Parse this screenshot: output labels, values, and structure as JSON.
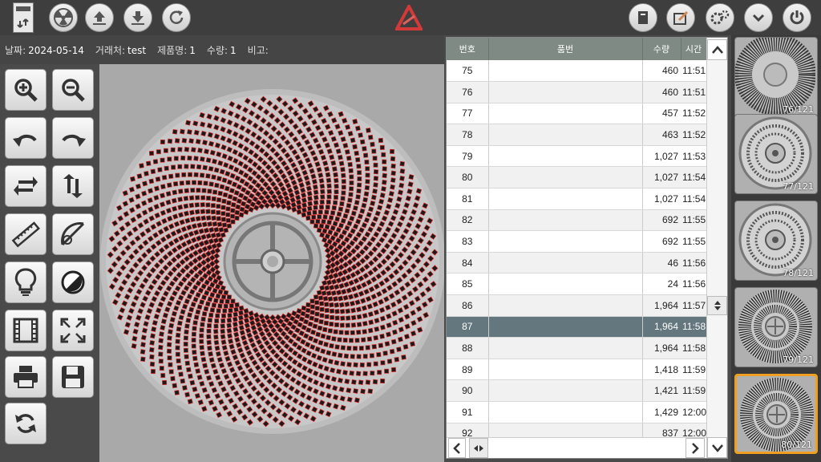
{
  "info": {
    "date_label": "날짜:",
    "date_value": "2024-05-14",
    "client_label": "거래처:",
    "client_value": "test",
    "product_label": "제품명:",
    "product_value": "1",
    "qty_label": "수량:",
    "qty_value": "1",
    "note_label": "비고:",
    "note_value": ""
  },
  "table": {
    "headers": [
      "번호",
      "품번",
      "수량",
      "시간"
    ],
    "rows": [
      {
        "no": "75",
        "part": "",
        "qty": "460",
        "time": "11:51"
      },
      {
        "no": "76",
        "part": "",
        "qty": "460",
        "time": "11:51"
      },
      {
        "no": "77",
        "part": "",
        "qty": "457",
        "time": "11:52"
      },
      {
        "no": "78",
        "part": "",
        "qty": "463",
        "time": "11:52"
      },
      {
        "no": "79",
        "part": "",
        "qty": "1,027",
        "time": "11:53"
      },
      {
        "no": "80",
        "part": "",
        "qty": "1,027",
        "time": "11:54"
      },
      {
        "no": "81",
        "part": "",
        "qty": "1,027",
        "time": "11:54"
      },
      {
        "no": "82",
        "part": "",
        "qty": "692",
        "time": "11:55"
      },
      {
        "no": "83",
        "part": "",
        "qty": "692",
        "time": "11:55"
      },
      {
        "no": "84",
        "part": "",
        "qty": "46",
        "time": "11:56"
      },
      {
        "no": "85",
        "part": "",
        "qty": "24",
        "time": "11:56"
      },
      {
        "no": "86",
        "part": "",
        "qty": "1,964",
        "time": "11:57"
      },
      {
        "no": "87",
        "part": "",
        "qty": "1,964",
        "time": "11:58"
      },
      {
        "no": "88",
        "part": "",
        "qty": "1,964",
        "time": "11:58"
      },
      {
        "no": "89",
        "part": "",
        "qty": "1,418",
        "time": "11:59"
      },
      {
        "no": "90",
        "part": "",
        "qty": "1,421",
        "time": "11:59"
      },
      {
        "no": "91",
        "part": "",
        "qty": "1,429",
        "time": "12:00"
      },
      {
        "no": "92",
        "part": "",
        "qty": "837",
        "time": "12:00"
      }
    ],
    "selected_row": "87"
  },
  "thumbnails": [
    {
      "count": "76/121",
      "style": "dense"
    },
    {
      "count": "77/121",
      "style": "reel"
    },
    {
      "count": "78/121",
      "style": "reel"
    },
    {
      "count": "79/121",
      "style": "spiral"
    },
    {
      "count": "80/121",
      "style": "spiral"
    }
  ],
  "selected_thumbnail": "80/121",
  "colors": {
    "accent_orange": "#f0a020",
    "row_selected": "#64767e",
    "header_bg": "#7f8a84",
    "detection_red": "#e03030",
    "logo_red": "#d23a3a"
  },
  "icons": {
    "top_left": [
      "document-icon",
      "radiation-icon",
      "upload-icon",
      "download-icon",
      "refresh-icon"
    ],
    "top_right": [
      "book-icon",
      "edit-icon",
      "settings-icon",
      "chevron-down-icon",
      "power-icon"
    ],
    "tools": [
      "zoom-in-icon",
      "zoom-out-icon",
      "rotate-left-icon",
      "rotate-right-icon",
      "flip-horizontal-icon",
      "flip-vertical-icon",
      "ruler-icon",
      "protractor-icon",
      "lightbulb-icon",
      "contrast-icon",
      "film-icon",
      "fullscreen-icon",
      "print-icon",
      "save-icon",
      "reload-icon"
    ]
  }
}
